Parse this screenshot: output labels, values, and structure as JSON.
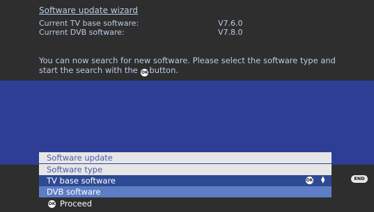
{
  "wizard": {
    "title": "Software update wizard",
    "tv_label": "Current TV base software:",
    "tv_value": "V7.6.0",
    "dvb_label": "Current DVB software:",
    "dvb_value": "V7.8.0",
    "instructions_before": "You can now search for new software. Please select the software type and start the search with the ",
    "instructions_after": "button."
  },
  "menu": {
    "software_update": "Software update",
    "software_type": "Software type",
    "options": [
      "TV base software",
      "DVB software"
    ],
    "selected": "TV base software"
  },
  "buttons": {
    "ok_glyph": "OK",
    "end": "END",
    "proceed": "Proceed"
  },
  "colors": {
    "background": "#2e2e2e",
    "panel_blue": "#2d3e94",
    "text_light_blue": "#b9cde6",
    "selected_item": "#2d4a93",
    "highlight_item": "#5d7dc5",
    "header_item": "#e6e6e6"
  }
}
